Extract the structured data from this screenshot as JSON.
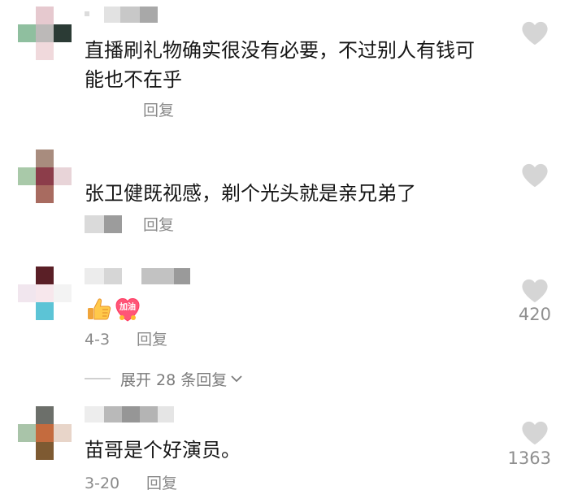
{
  "comments": [
    {
      "text": "直播刷礼物确实很没有必要，不过别人有钱可能也不在乎",
      "line1": "直播刷礼物确实很没有必要，不过别人有钱可",
      "line2": "能也不在乎",
      "reply_label": "回复"
    },
    {
      "text": "张卫健既视感，剃个光头就是亲兄弟了",
      "reply_label": "回复"
    },
    {
      "emoji": [
        "thumbs-up",
        "加油"
      ],
      "emoji_text": "加油",
      "date": "4-3",
      "reply_label": "回复",
      "like_count": "420"
    },
    {
      "text": "苗哥是个好演员。",
      "date": "3-20",
      "reply_label": "回复",
      "like_count": "1363"
    }
  ],
  "expand_replies": {
    "label": "展开 28 条回复"
  },
  "icons": {
    "like": "heart-icon",
    "expand": "chevron-down-icon"
  },
  "colors": {
    "heart": "#d5d5d5",
    "text": "#161616",
    "meta": "#8a8a8a"
  }
}
